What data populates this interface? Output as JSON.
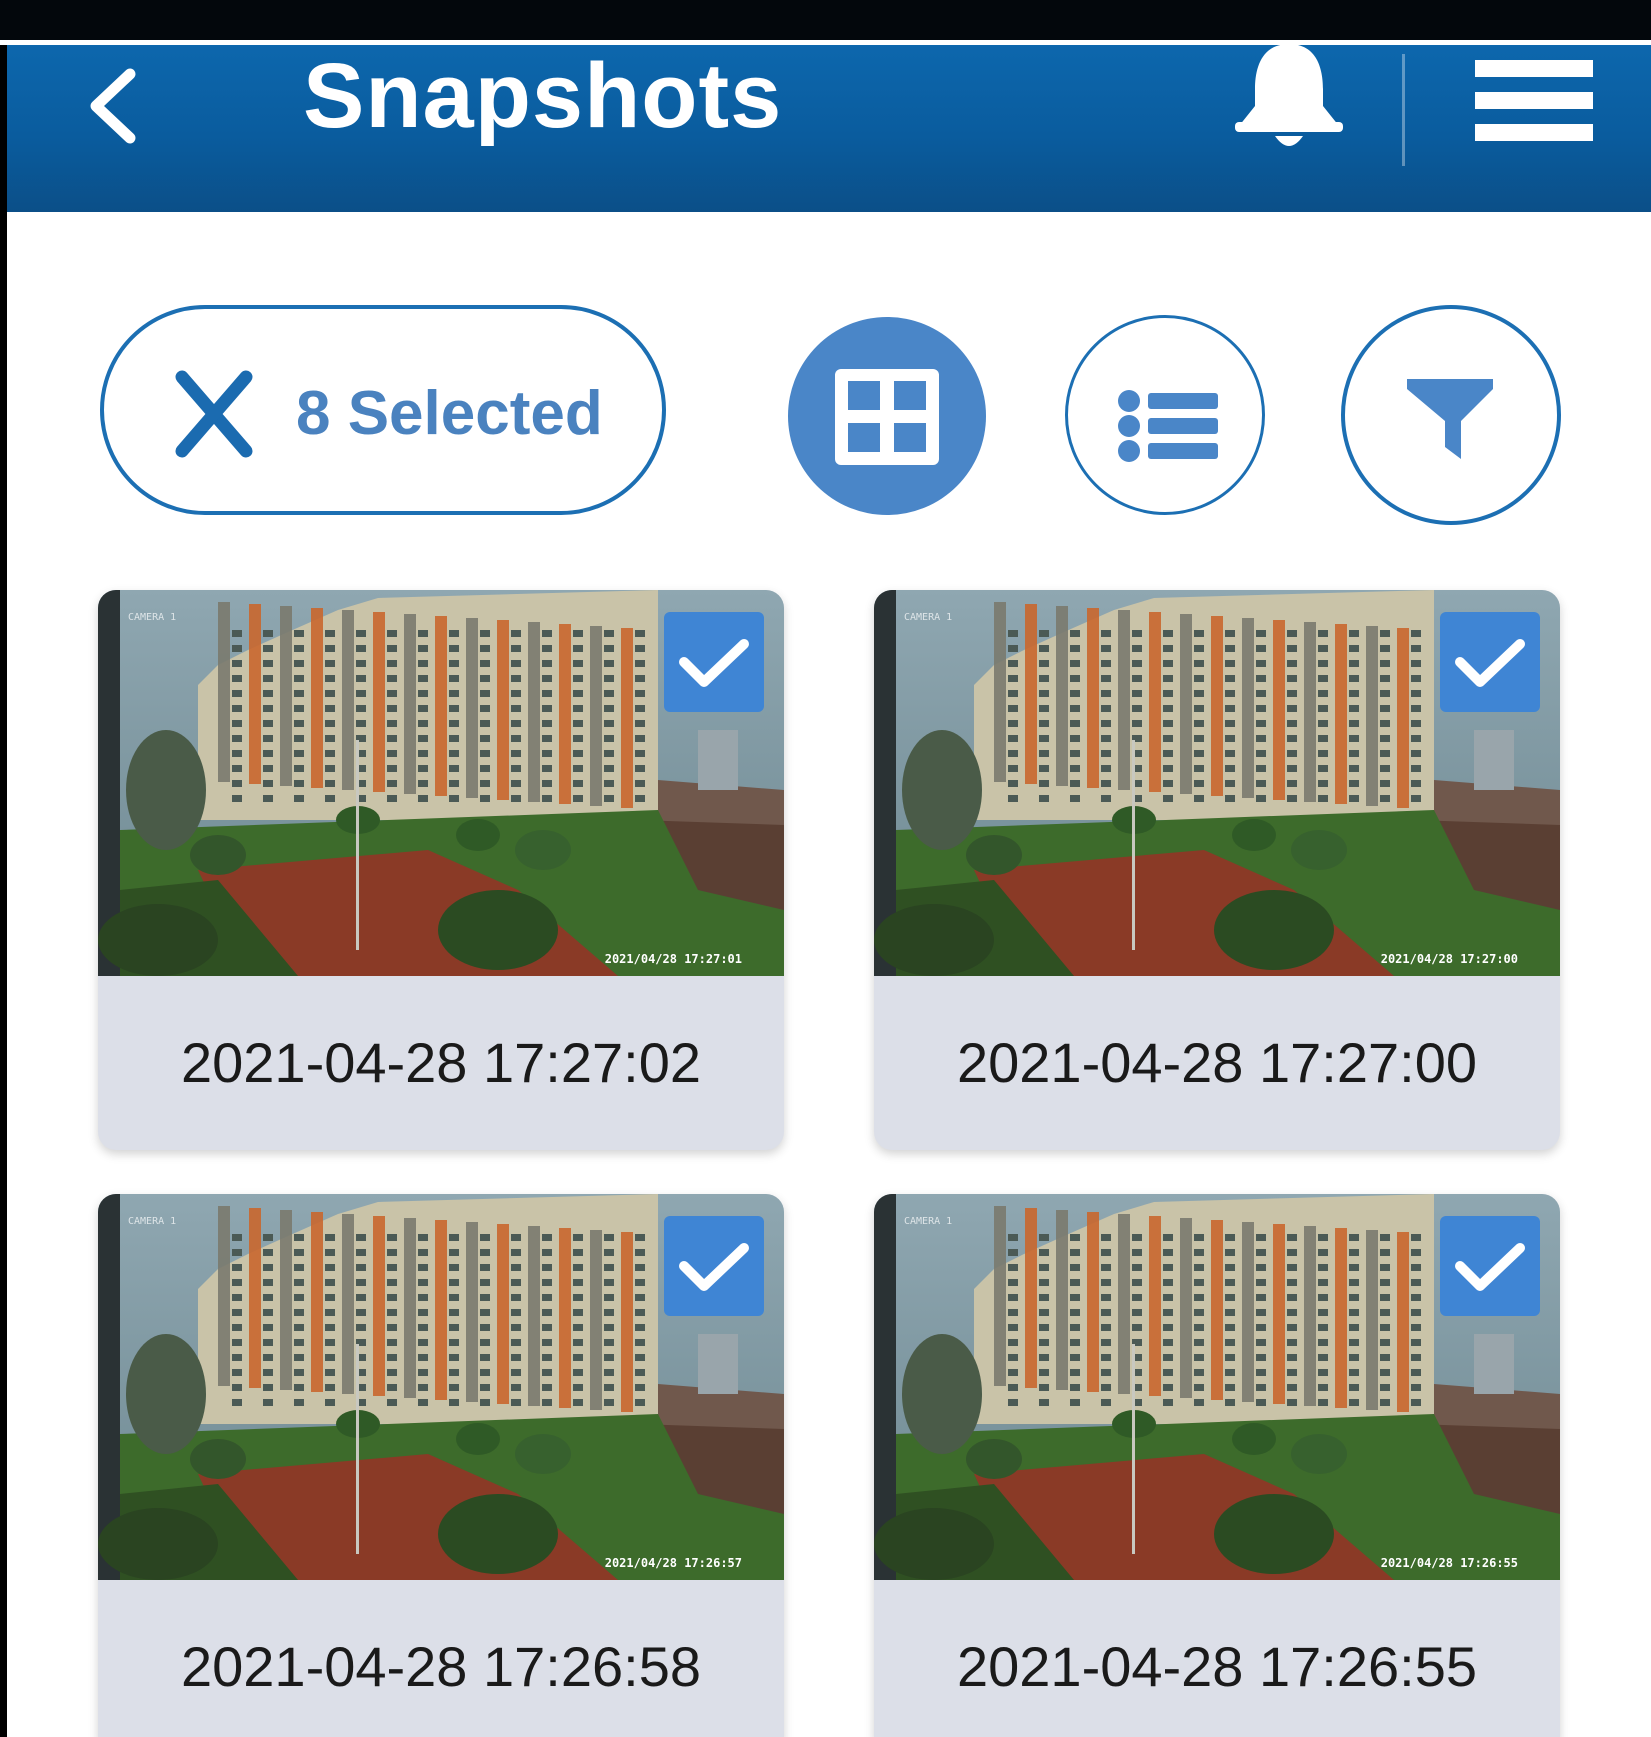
{
  "header": {
    "title": "Snapshots",
    "background_color": "#0b5fa3"
  },
  "toolbar": {
    "selection_label": "8 Selected",
    "accent_color": "#1c6fb3",
    "views": [
      {
        "name": "grid-view",
        "active": true
      },
      {
        "name": "list-view",
        "active": false
      },
      {
        "name": "filter",
        "active": false
      }
    ]
  },
  "snapshots": [
    {
      "caption": "2021-04-28 17:27:02",
      "overlay_timestamp": "2021/04/28  17:27:01",
      "selected": true
    },
    {
      "caption": "2021-04-28 17:27:00",
      "overlay_timestamp": "2021/04/28  17:27:00",
      "selected": true
    },
    {
      "caption": "2021-04-28 17:26:58",
      "overlay_timestamp": "2021/04/28  17:26:57",
      "selected": true
    },
    {
      "caption": "2021-04-28 17:26:55",
      "overlay_timestamp": "2021/04/28  17:26:55",
      "selected": true
    }
  ],
  "icons": {
    "back": "chevron-left-icon",
    "notifications": "bell-icon",
    "menu": "hamburger-menu-icon",
    "deselect": "close-icon",
    "grid": "grid-icon",
    "list": "list-icon",
    "filter": "filter-icon",
    "check": "checkmark-icon"
  }
}
